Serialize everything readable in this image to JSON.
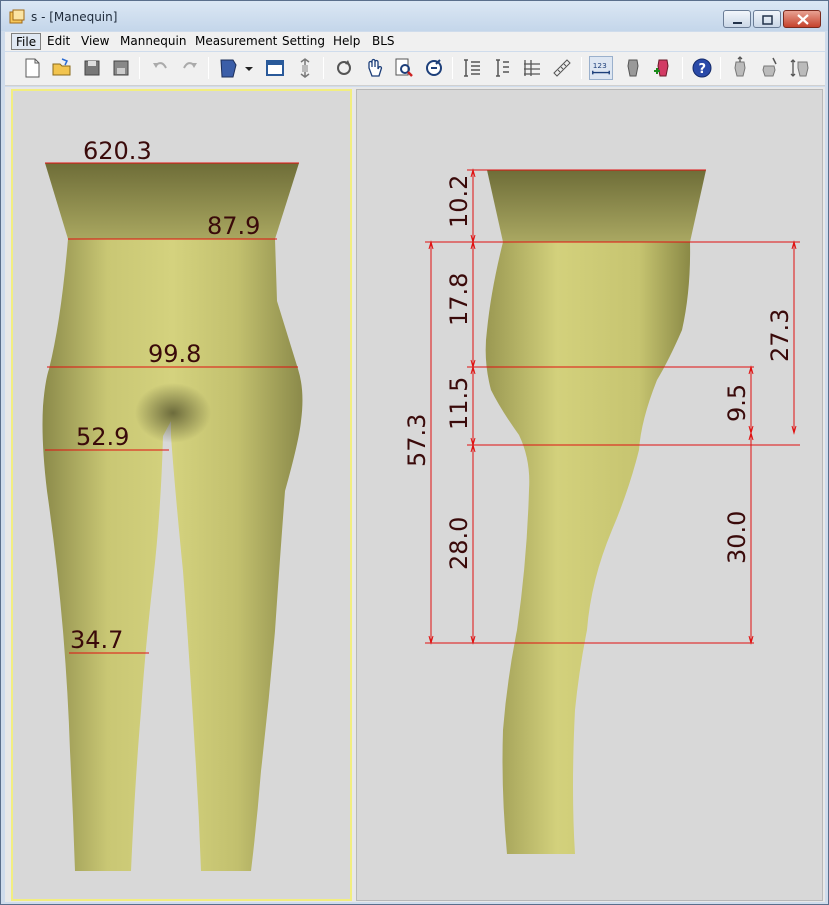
{
  "window": {
    "title": "s - [Manequin]"
  },
  "menu": [
    "File",
    "Edit",
    "View",
    "Mannequin",
    "Measurement",
    "Setting",
    "Help",
    "BLS"
  ],
  "toolbar_icons": [
    "new-file-icon",
    "open-folder-icon",
    "save-icon",
    "save-as-icon",
    "undo-icon",
    "redo-icon",
    "model-icon",
    "dropdown-arrow-icon",
    "window-icon",
    "fit-icon",
    "rotate-icon",
    "pan-hand-icon",
    "zoom-icon",
    "reset-view-icon",
    "measure-vertical-icon",
    "measure-vertical-2-icon",
    "measure-grid-icon",
    "ruler-icon",
    "number-label-icon",
    "body-front-icon",
    "body-add-icon",
    "help-icon",
    "body-top-icon",
    "body-cut-icon",
    "body-height-icon"
  ],
  "front_view": {
    "measurements": {
      "top": "620.3",
      "waist": "87.9",
      "hip": "99.8",
      "thigh": "52.9",
      "knee": "34.7"
    }
  },
  "side_view": {
    "measurements": {
      "m1": "10.2",
      "m2": "17.8",
      "m3": "11.5",
      "m4": "57.3",
      "m5": "28.0",
      "m6": "27.3",
      "m7": "9.5",
      "m8": "30.0"
    }
  },
  "colors": {
    "measure_line": "#e01010",
    "measure_text": "#3a0a0a",
    "body": "#c9c774",
    "selected_border": "#f2ee80"
  }
}
